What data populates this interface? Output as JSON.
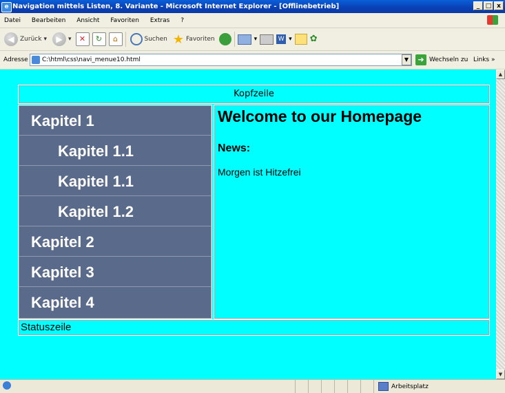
{
  "window": {
    "title": "Navigation mittels Listen, 8. Variante - Microsoft Internet Explorer - [Offlinebetrieb]",
    "buttons": [
      "_",
      "□",
      "x"
    ]
  },
  "menubar": {
    "items": [
      "Datei",
      "Bearbeiten",
      "Ansicht",
      "Favoriten",
      "Extras",
      "?"
    ]
  },
  "toolbar": {
    "back_label": "Zurück",
    "search_label": "Suchen",
    "favorites_label": "Favoriten"
  },
  "address": {
    "label": "Adresse",
    "value": "C:\\html\\css\\navi_menue10.html",
    "go_label": "Wechseln zu",
    "links_label": "Links",
    "links_more": "»"
  },
  "page": {
    "header": "Kopfzeile",
    "nav": [
      {
        "label": "Kapitel 1",
        "level": 1
      },
      {
        "label": "Kapitel 1.1",
        "level": 2
      },
      {
        "label": "Kapitel 1.1",
        "level": 2
      },
      {
        "label": "Kapitel 1.2",
        "level": 2
      },
      {
        "label": "Kapitel 2",
        "level": 1
      },
      {
        "label": "Kapitel 3",
        "level": 1
      },
      {
        "label": "Kapitel 4",
        "level": 1
      }
    ],
    "heading": "Welcome to our Homepage",
    "news_heading": "News:",
    "news_text": "Morgen ist Hitzefrei",
    "footer": "Statuszeile",
    "colors": {
      "background": "#00ffff",
      "nav": "#5a6a8a"
    }
  },
  "statusbar": {
    "zone": "Arbeitsplatz"
  }
}
